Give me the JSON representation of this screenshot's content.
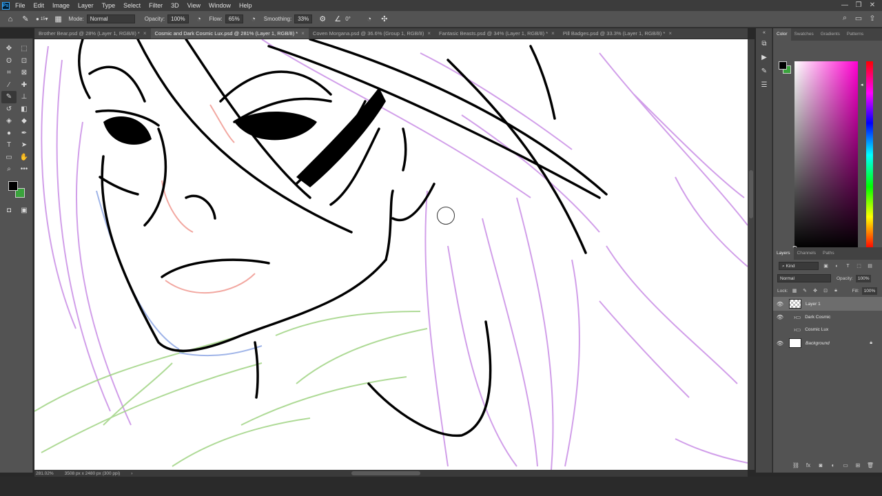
{
  "menubar": {
    "logo": "Ps",
    "items": [
      "File",
      "Edit",
      "Image",
      "Layer",
      "Type",
      "Select",
      "Filter",
      "3D",
      "View",
      "Window",
      "Help"
    ],
    "window_controls": [
      "—",
      "❐",
      "✕"
    ]
  },
  "options": {
    "brush_size": "15",
    "mode_label": "Mode:",
    "mode_value": "Normal",
    "opacity_label": "Opacity:",
    "opacity_value": "100%",
    "flow_label": "Flow:",
    "flow_value": "65%",
    "smoothing_label": "Smoothing:",
    "smoothing_value": "33%",
    "angle_value": "0°"
  },
  "tabs": [
    {
      "label": "Brother Bear.psd @ 28% (Layer 1, RGB/8) *"
    },
    {
      "label": "Cosmic and Dark Cosmic Lux.psd @ 281% (Layer 1, RGB/8) *"
    },
    {
      "label": "Coven Morgana.psd @ 36.6% (Group 1, RGB/8)"
    },
    {
      "label": "Fantasic Beasts.psd @ 34% (Layer 1, RGB/8) *"
    },
    {
      "label": "Pill Badges.psd @ 33.3% (Layer 1, RGB/8) *"
    }
  ],
  "status": {
    "zoom": "281.02%",
    "doc_size": "3508 px x 2480 px (300 ppi)"
  },
  "right_panel": {
    "color_tabs": [
      "Color",
      "Swatches",
      "Gradients",
      "Patterns"
    ],
    "layer_tabs": [
      "Layers",
      "Channels",
      "Paths"
    ],
    "kind_label": "Kind",
    "blend_mode": "Normal",
    "opacity_label": "Opacity:",
    "opacity_value": "100%",
    "lock_label": "Lock:",
    "fill_label": "Fill:",
    "fill_value": "100%",
    "layers": [
      {
        "name": "Layer 1"
      },
      {
        "name": "Dark Cosmic"
      },
      {
        "name": "Cosmic Lux"
      },
      {
        "name": "Background"
      }
    ]
  },
  "colors": {
    "foreground": "#000000",
    "background": "#3aa33c",
    "accent_blue": "#31a8ff"
  }
}
